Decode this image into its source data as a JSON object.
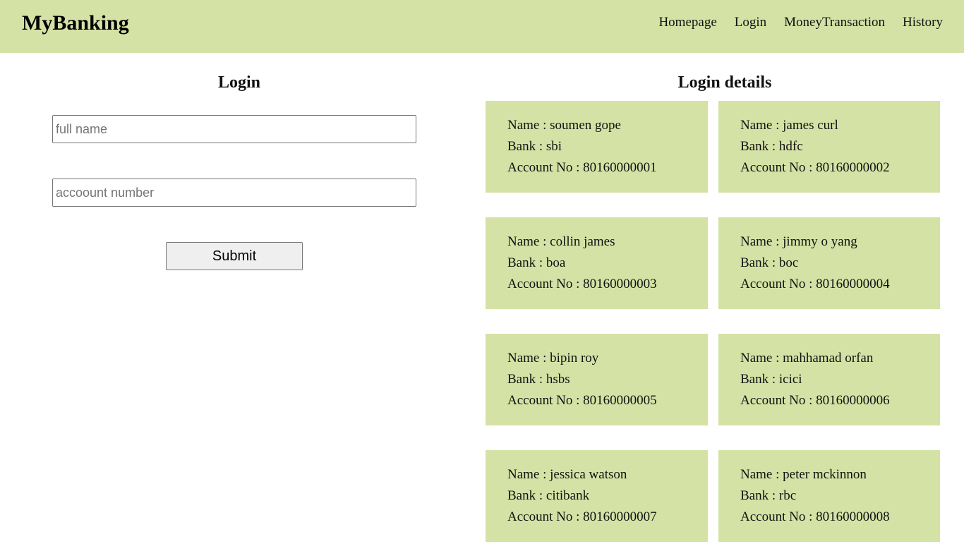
{
  "navbar": {
    "brand": "MyBanking",
    "links": [
      "Homepage",
      "Login",
      "MoneyTransaction",
      "History"
    ]
  },
  "login": {
    "title": "Login",
    "name_placeholder": "full name",
    "account_placeholder": "accoount number",
    "submit_label": "Submit"
  },
  "details": {
    "title": "Login details",
    "cards": [
      {
        "name": "Name : soumen gope",
        "bank": "Bank : sbi",
        "account": "Account No : 80160000001"
      },
      {
        "name": "Name : james curl",
        "bank": "Bank : hdfc",
        "account": "Account No : 80160000002"
      },
      {
        "name": "Name : collin james",
        "bank": "Bank : boa",
        "account": "Account No : 80160000003"
      },
      {
        "name": "Name : jimmy o yang",
        "bank": "Bank : boc",
        "account": "Account No : 80160000004"
      },
      {
        "name": "Name : bipin roy",
        "bank": "Bank : hsbs",
        "account": "Account No : 80160000005"
      },
      {
        "name": "Name : mahhamad orfan",
        "bank": "Bank : icici",
        "account": "Account No : 80160000006"
      },
      {
        "name": "Name : jessica watson",
        "bank": "Bank : citibank",
        "account": "Account No : 80160000007"
      },
      {
        "name": "Name : peter mckinnon",
        "bank": "Bank : rbc",
        "account": "Account No : 80160000008"
      }
    ]
  },
  "colors": {
    "accent": "#d5e2a5"
  }
}
